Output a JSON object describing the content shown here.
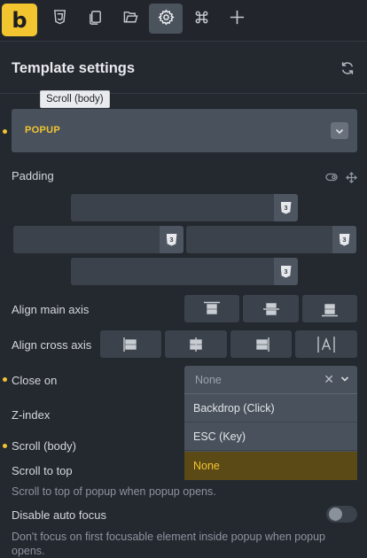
{
  "toolbar": {
    "logo_letter": "b",
    "icons": [
      "css3-icon",
      "pages-icon",
      "folder-icon",
      "gear-icon",
      "command-icon",
      "plus-icon"
    ],
    "active": "gear-icon",
    "accent_color": "#f2c430"
  },
  "header": {
    "title": "Template settings",
    "refresh_icon": "refresh-icon"
  },
  "tooltip": {
    "text": "Scroll (body)"
  },
  "popup_type": {
    "value": "POPUP"
  },
  "padding": {
    "label": "Padding",
    "css_badge": "3"
  },
  "align_main": {
    "label": "Align main axis"
  },
  "align_cross": {
    "label": "Align cross axis",
    "options": [
      "stretch-left",
      "center",
      "stretch-right",
      "text"
    ]
  },
  "close_on": {
    "label": "Close on",
    "placeholder": "None",
    "options": [
      "Backdrop (Click)",
      "ESC (Key)",
      "None"
    ],
    "selected": "None"
  },
  "zindex": {
    "label": "Z-index"
  },
  "scroll_body": {
    "label": "Scroll (body)"
  },
  "scroll_top": {
    "label": "Scroll to top",
    "description": "Scroll to top of popup when popup opens."
  },
  "auto_focus": {
    "label": "Disable auto focus",
    "description": "Don't focus on first focusable element inside popup when popup opens.",
    "enabled": false
  }
}
